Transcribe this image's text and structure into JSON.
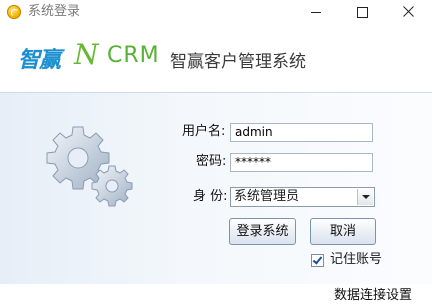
{
  "window": {
    "title": "系统登录",
    "app_icon": "app-logo-icon",
    "controls": [
      "minimize-icon",
      "maximize-icon",
      "close-icon"
    ]
  },
  "banner": {
    "logo_text": "智赢",
    "logo_n": "N",
    "logo_crm": "CRM",
    "subtitle": "智赢客户管理系统",
    "brand_blue": "#1c8fd0",
    "brand_green": "#58b034"
  },
  "form": {
    "username_label": "用户名:",
    "username_value": "admin",
    "password_label": "密码:",
    "password_value": "******",
    "role_label": "身 份:",
    "role_value": "系统管理员",
    "login_button": "登录系统",
    "cancel_button": "取消",
    "remember_label": "记住账号",
    "remember_checked": true
  },
  "footer": {
    "db_settings_link": "数据连接设置"
  }
}
